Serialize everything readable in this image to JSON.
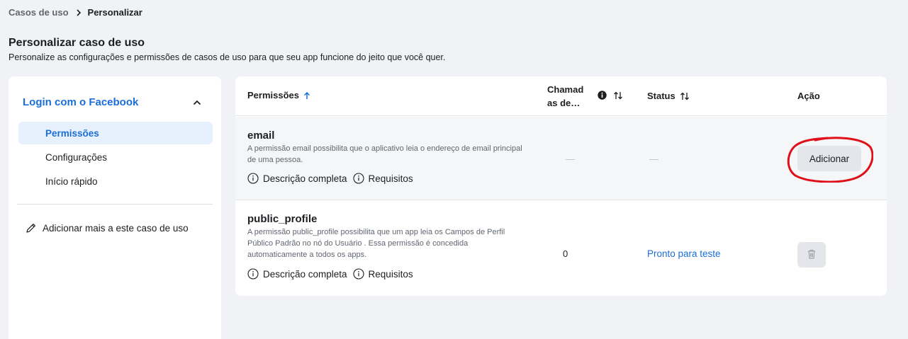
{
  "breadcrumb": {
    "parent": "Casos de uso",
    "current": "Personalizar"
  },
  "page": {
    "title": "Personalizar caso de uso",
    "subtitle": "Personalize as configurações e permissões de casos de uso para que seu app funcione do jeito que você quer."
  },
  "sidebar": {
    "usecase_title": "Login com o Facebook",
    "items": [
      {
        "label": "Permissões",
        "active": true
      },
      {
        "label": "Configurações",
        "active": false
      },
      {
        "label": "Início rápido",
        "active": false
      }
    ],
    "add_more_label": "Adicionar mais a este caso de uso"
  },
  "table": {
    "headers": {
      "permissions": "Permissões",
      "calls": "Chamad as de…",
      "status": "Status",
      "action": "Ação"
    },
    "rows": [
      {
        "name": "email",
        "description": "A permissão email possibilita que o aplicativo leia o endereço de email principal de uma pessoa.",
        "full_description_label": "Descrição completa",
        "requirements_label": "Requisitos",
        "calls": "—",
        "status": "—",
        "action_label": "Adicionar"
      },
      {
        "name": "public_profile",
        "description": "A permissão public_profile possibilita que um app leia os Campos de Perfil Público Padrão no nó do Usuário . Essa permissão é concedida automaticamente a todos os apps.",
        "full_description_label": "Descrição completa",
        "requirements_label": "Requisitos",
        "calls": "0",
        "status": "Pronto para teste",
        "action_icon": "trash-icon"
      }
    ]
  },
  "colors": {
    "accent": "#1a6ed8",
    "annotation": "#e0101a",
    "background": "#f0f2f5"
  }
}
